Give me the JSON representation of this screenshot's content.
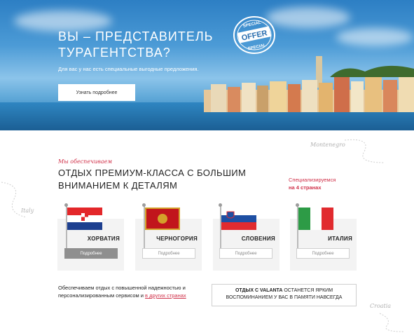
{
  "hero": {
    "title": "ВЫ – ПРЕДСТАВИТЕЛЬ ТУРАГЕНТСТВА?",
    "subtitle": "Для вас у нас есть специальные выгодные предложения.",
    "button_label": "Узнать подробнее",
    "stamp": {
      "top": "SPECIAL",
      "main": "OFFER",
      "bottom": "SPECIAL"
    }
  },
  "section": {
    "kicker": "Мы обеспечиваем",
    "title": "ОТДЫХ ПРЕМИУМ-КЛАССА С БОЛЬШИМ ВНИМАНИЕМ К ДЕТАЛЯМ",
    "spec_line1": "Специализируемся",
    "spec_line2": "на 4 странах",
    "script_labels": {
      "montenegro": "Montenegro",
      "italy": "Italy",
      "croatia": "Croatia"
    }
  },
  "countries": [
    {
      "name": "ХОРВАТИЯ",
      "button": "Подробнее",
      "active": true
    },
    {
      "name": "ЧЕРНОГОРИЯ",
      "button": "Подробнее",
      "active": false
    },
    {
      "name": "СЛОВЕНИЯ",
      "button": "Подробнее",
      "active": false
    },
    {
      "name": "ИТАЛИЯ",
      "button": "Подробнее",
      "active": false
    }
  ],
  "bottom": {
    "text_before": "Обеспечиваем отдых с повышенной надежностью и персонализированным сервисом и ",
    "link": "в других странах",
    "quote_bold": "ОТДЫХ С VALANTA",
    "quote_rest": " ОСТАНЕТСЯ ЯРКИМ ВОСПОМИНАНИЕМ У ВАС В ПАМЯТИ НАВСЕГДА"
  },
  "colors": {
    "accent": "#d0324a",
    "button_active": "#8f8f8f"
  }
}
